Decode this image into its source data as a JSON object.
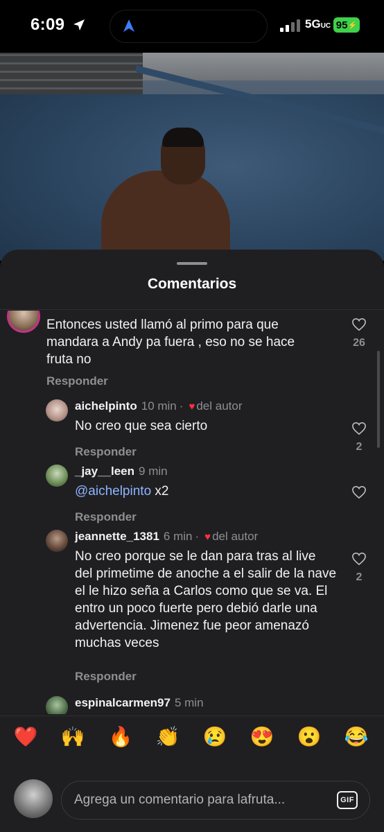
{
  "status_bar": {
    "time": "6:09",
    "network": "5G",
    "network_sub": "UC",
    "battery": "95"
  },
  "sheet": {
    "title": "Comentarios"
  },
  "comments": [
    {
      "username": "",
      "time": "",
      "text": "Entonces usted llamó al primo para que mandara a Andy pa fuera , eso no se hace fruta no",
      "reply": "Responder",
      "likes": "26"
    },
    {
      "username": "aichelpinto",
      "time": "10 min",
      "author_badge": "del autor",
      "text": "No creo que sea cierto",
      "reply": "Responder",
      "likes": "2"
    },
    {
      "username": "_jay__leen",
      "time": "9 min",
      "mention": "@aichelpinto",
      "text_after": " x2",
      "reply": "Responder",
      "likes": ""
    },
    {
      "username": "jeannette_1381",
      "time": "6 min",
      "author_badge": "del autor",
      "text": "No creo porque se le dan para tras al live del primetime de anoche a el salir de la nave el le hizo seña a Carlos como que se va. El entro un poco fuerte pero debió darle una advertencia. Jimenez fue peor amenazó muchas veces",
      "reply": "Responder",
      "likes": "2"
    },
    {
      "username": "espinalcarmen97",
      "time": "5 min"
    }
  ],
  "emoji_bar": [
    "❤️",
    "🙌",
    "🔥",
    "👏",
    "😢",
    "😍",
    "😮",
    "😂"
  ],
  "input": {
    "placeholder": "Agrega un comentario para lafruta...",
    "gif_label": "GIF"
  },
  "icons": {
    "heart_outline": "heart-outline-icon",
    "heart_author": "heart-filled-icon",
    "gif": "gif-icon"
  },
  "colors": {
    "sheet_bg": "#1f1f22",
    "mention": "#8fb4ff",
    "author_heart": "#ff3040",
    "battery": "#3ed14a"
  }
}
